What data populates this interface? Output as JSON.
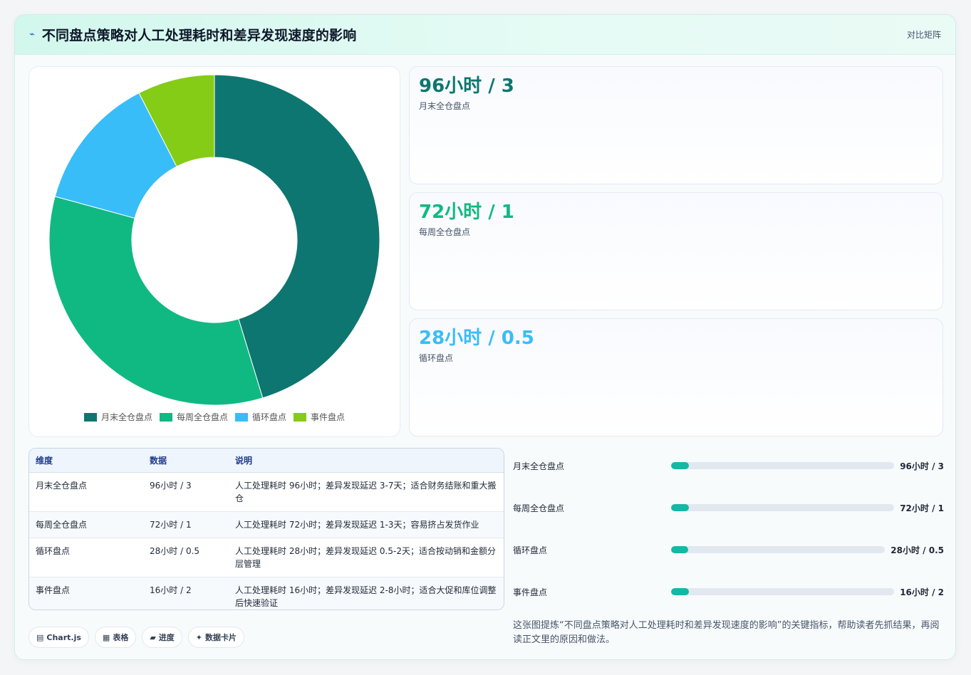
{
  "header": {
    "icon": "sparkle-icon",
    "title": "不同盘点策略对人工处理耗时和差异发现速度的影响",
    "badge": "对比矩阵"
  },
  "colors": {
    "teal_dark": "#0e7670",
    "green": "#10b981",
    "sky": "#38bdf8",
    "lime": "#84cc16",
    "progress": "#14b8a6"
  },
  "chart_data": {
    "type": "pie",
    "categories": [
      "月末全仓盘点",
      "每周全仓盘点",
      "循环盘点",
      "事件盘点"
    ],
    "values": [
      96,
      72,
      28,
      16
    ],
    "colors": [
      "#0e7670",
      "#10b981",
      "#38bdf8",
      "#84cc16"
    ],
    "donut": true,
    "legend_position": "bottom"
  },
  "kpis": [
    {
      "value": "96小时 / 3",
      "label": "月末全仓盘点",
      "color": "#0e7670"
    },
    {
      "value": "72小时 / 1",
      "label": "每周全仓盘点",
      "color": "#10b981"
    },
    {
      "value": "28小时 / 0.5",
      "label": "循环盘点",
      "color": "#38bdf8"
    }
  ],
  "table": {
    "headers": [
      "维度",
      "数据",
      "说明"
    ],
    "rows": [
      [
        "月末全仓盘点",
        "96小时 / 3",
        "人工处理耗时 96小时；差异发现延迟 3-7天；适合财务结账和重大搬仓"
      ],
      [
        "每周全仓盘点",
        "72小时 / 1",
        "人工处理耗时 72小时；差异发现延迟 1-3天；容易挤占发货作业"
      ],
      [
        "循环盘点",
        "28小时 / 0.5",
        "人工处理耗时 28小时；差异发现延迟 0.5-2天；适合按动销和金额分层管理"
      ],
      [
        "事件盘点",
        "16小时 / 2",
        "人工处理耗时 16小时；差异发现延迟 2-8小时；适合大促和库位调整后快速验证"
      ]
    ]
  },
  "progress": [
    {
      "label": "月末全仓盘点",
      "value": "96小时 / 3",
      "fraction": 0.08
    },
    {
      "label": "每周全仓盘点",
      "value": "72小时 / 1",
      "fraction": 0.08
    },
    {
      "label": "循环盘点",
      "value": "28小时 / 0.5",
      "fraction": 0.08
    },
    {
      "label": "事件盘点",
      "value": "16小时 / 2",
      "fraction": 0.08
    }
  ],
  "note": "这张图提炼“不同盘点策略对人工处理耗时和差异发现速度的影响”的关键指标，帮助读者先抓结果，再阅读正文里的原因和做法。",
  "chips": [
    {
      "icon": "chart-icon",
      "label": "Chart.js"
    },
    {
      "icon": "table-icon",
      "label": "表格"
    },
    {
      "icon": "progress-icon",
      "label": "进度"
    },
    {
      "icon": "card-icon",
      "label": "数据卡片"
    }
  ]
}
